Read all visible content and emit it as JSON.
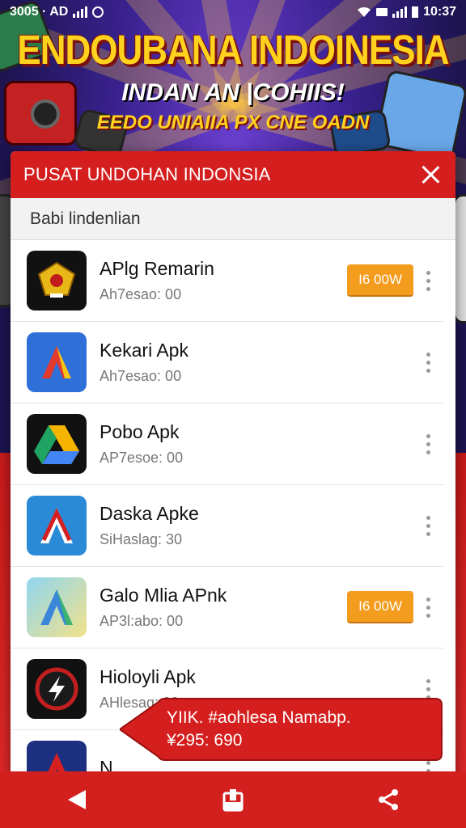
{
  "status_bar": {
    "left_text": "3005 · AD",
    "time": "10:37"
  },
  "banner": {
    "headline": "ENDOUBANA INDOINESIA",
    "subline": "INDAN AN |COHIIS!",
    "tagline": "EEDO UNIAIIA PX CNE OADN"
  },
  "dialog": {
    "title": "PUSAT UNDOHAN INDONSIA",
    "close_icon": "close-icon",
    "search_text": "Babi lindenlian"
  },
  "apps": [
    {
      "name": "APlg Remarin",
      "sub": "Ah7esao: 00",
      "button": "I6 00W",
      "icon": "garuda-emblem-icon"
    },
    {
      "name": "Kekari Apk",
      "sub": "Ah7esao: 00",
      "button": "",
      "icon": "blue-a-logo-icon"
    },
    {
      "name": "Pobo Apk",
      "sub": "AP7esoe: 00",
      "button": "",
      "icon": "drive-triangle-icon"
    },
    {
      "name": "Daska Apke",
      "sub": "SiHaslag: 30",
      "button": "",
      "icon": "red-a-logo-icon"
    },
    {
      "name": "Galo Mlia APnk",
      "sub": "AP3l:abo: 00",
      "button": "I6 00W",
      "icon": "light-a-logo-icon"
    },
    {
      "name": "Hioloyli Apk",
      "sub": "AHlesag: 00",
      "button": "",
      "icon": "lightning-circle-icon"
    },
    {
      "name": "N",
      "sub": "",
      "button": "",
      "icon": "partial-a-logo-icon"
    }
  ],
  "toast": {
    "line1": "YIIK. #aohlesa Namabp.",
    "line2": "¥295: 690"
  },
  "nav": {
    "back_icon": "back-triangle-icon",
    "home_icon": "home-box-icon",
    "share_icon": "share-icon"
  },
  "colors": {
    "accent_red": "#d51e1e",
    "button_orange": "#f39c1e",
    "banner_purple": "#3a2290"
  }
}
